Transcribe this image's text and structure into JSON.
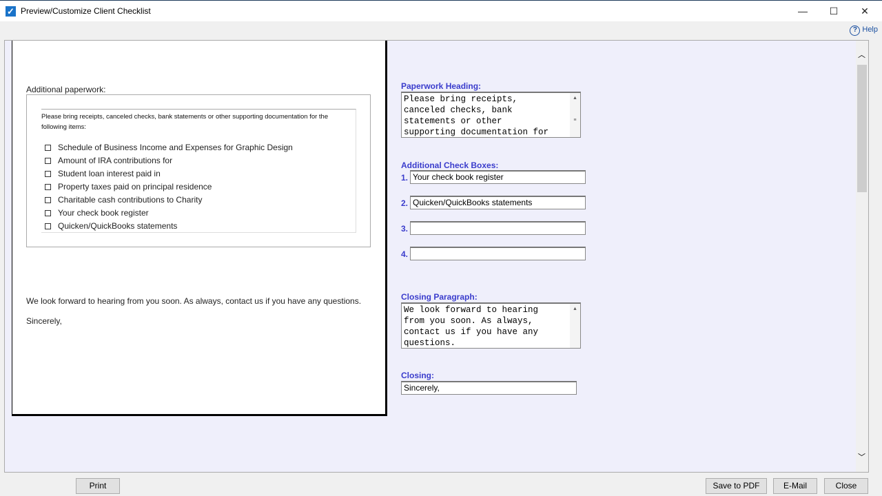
{
  "window": {
    "title": "Preview/Customize Client Checklist",
    "help": "Help"
  },
  "preview": {
    "heading": "Additional paperwork:",
    "intro": "Please bring receipts, canceled checks, bank statements or other supporting documentation for the following items:",
    "items": [
      "Schedule of Business Income and Expenses for Graphic Design",
      "Amount of IRA contributions for",
      "Student loan interest paid in",
      "Property taxes paid on principal residence",
      "Charitable cash contributions to Charity",
      "Your check book register",
      "Quicken/QuickBooks statements"
    ],
    "closing_paragraph": "We look forward to hearing from you soon. As always, contact us if you have any questions.",
    "closing": "Sincerely,"
  },
  "form": {
    "paperwork_heading_label": "Paperwork Heading:",
    "paperwork_heading_value": "Please bring receipts,\ncanceled checks, bank\nstatements or other\nsupporting documentation for",
    "check_boxes_label": "Additional Check Boxes:",
    "check_boxes": [
      {
        "num": "1.",
        "value": "Your check book register"
      },
      {
        "num": "2.",
        "value": "Quicken/QuickBooks statements"
      },
      {
        "num": "3.",
        "value": ""
      },
      {
        "num": "4.",
        "value": ""
      }
    ],
    "closing_paragraph_label": "Closing Paragraph:",
    "closing_paragraph_value": "We look forward to hearing\nfrom you soon. As always,\ncontact us if you have any\nquestions.",
    "closing_label": "Closing:",
    "closing_value": "Sincerely,"
  },
  "buttons": {
    "print": "Print",
    "save_pdf": "Save to PDF",
    "email": "E-Mail",
    "close": "Close"
  }
}
